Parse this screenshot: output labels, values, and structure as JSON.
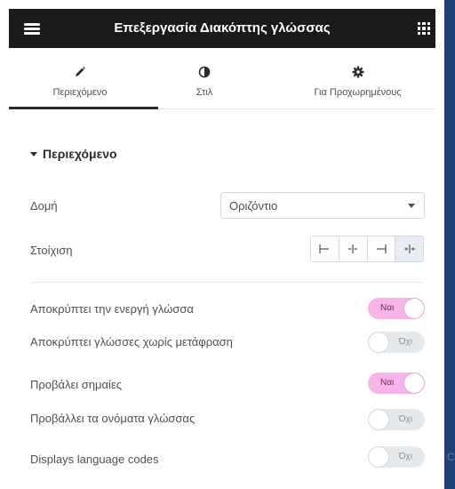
{
  "header": {
    "title": "Επεξεργασία Διακόπτης γλώσσας",
    "menu_icon": "hamburger-icon",
    "apps_icon": "grid-icon",
    "background": "#1a1a1a"
  },
  "tabs": [
    {
      "label": "Περιεχόμενο",
      "icon": "pencil-icon",
      "active": true
    },
    {
      "label": "Στιλ",
      "icon": "half-circle-icon",
      "active": false
    },
    {
      "label": "Για Προχωρημένους",
      "icon": "gear-icon",
      "active": false
    }
  ],
  "section": {
    "title": "Περιεχόμενο",
    "collapsed": false
  },
  "fields": {
    "structure": {
      "label": "Δομή",
      "value": "Οριζόντιο"
    },
    "alignment": {
      "label": "Στοίχιση",
      "options": [
        "align-left-icon",
        "align-center-icon",
        "align-right-icon",
        "align-justify-icon"
      ],
      "selected_index": 3
    }
  },
  "toggles": [
    {
      "label": "Αποκρύπτει την ενεργή γλώσσα",
      "state": "Ναι",
      "on": true
    },
    {
      "label": "Αποκρύπτει γλώσσες χωρίς μετάφραση",
      "state": "Όχι",
      "on": false
    },
    {
      "label": "Προβάλει σημαίες",
      "state": "Ναι",
      "on": true
    },
    {
      "label": "Προβάλλει τα ονόματα γλώσσας",
      "state": "Όχι",
      "on": false
    },
    {
      "label": "Displays language codes",
      "state": "Όχι",
      "on": false
    }
  ],
  "edge_text": "C",
  "colors": {
    "accent_on": "#f7b4e8",
    "off": "#e6e9ec",
    "edge": "#1e3f7a"
  }
}
